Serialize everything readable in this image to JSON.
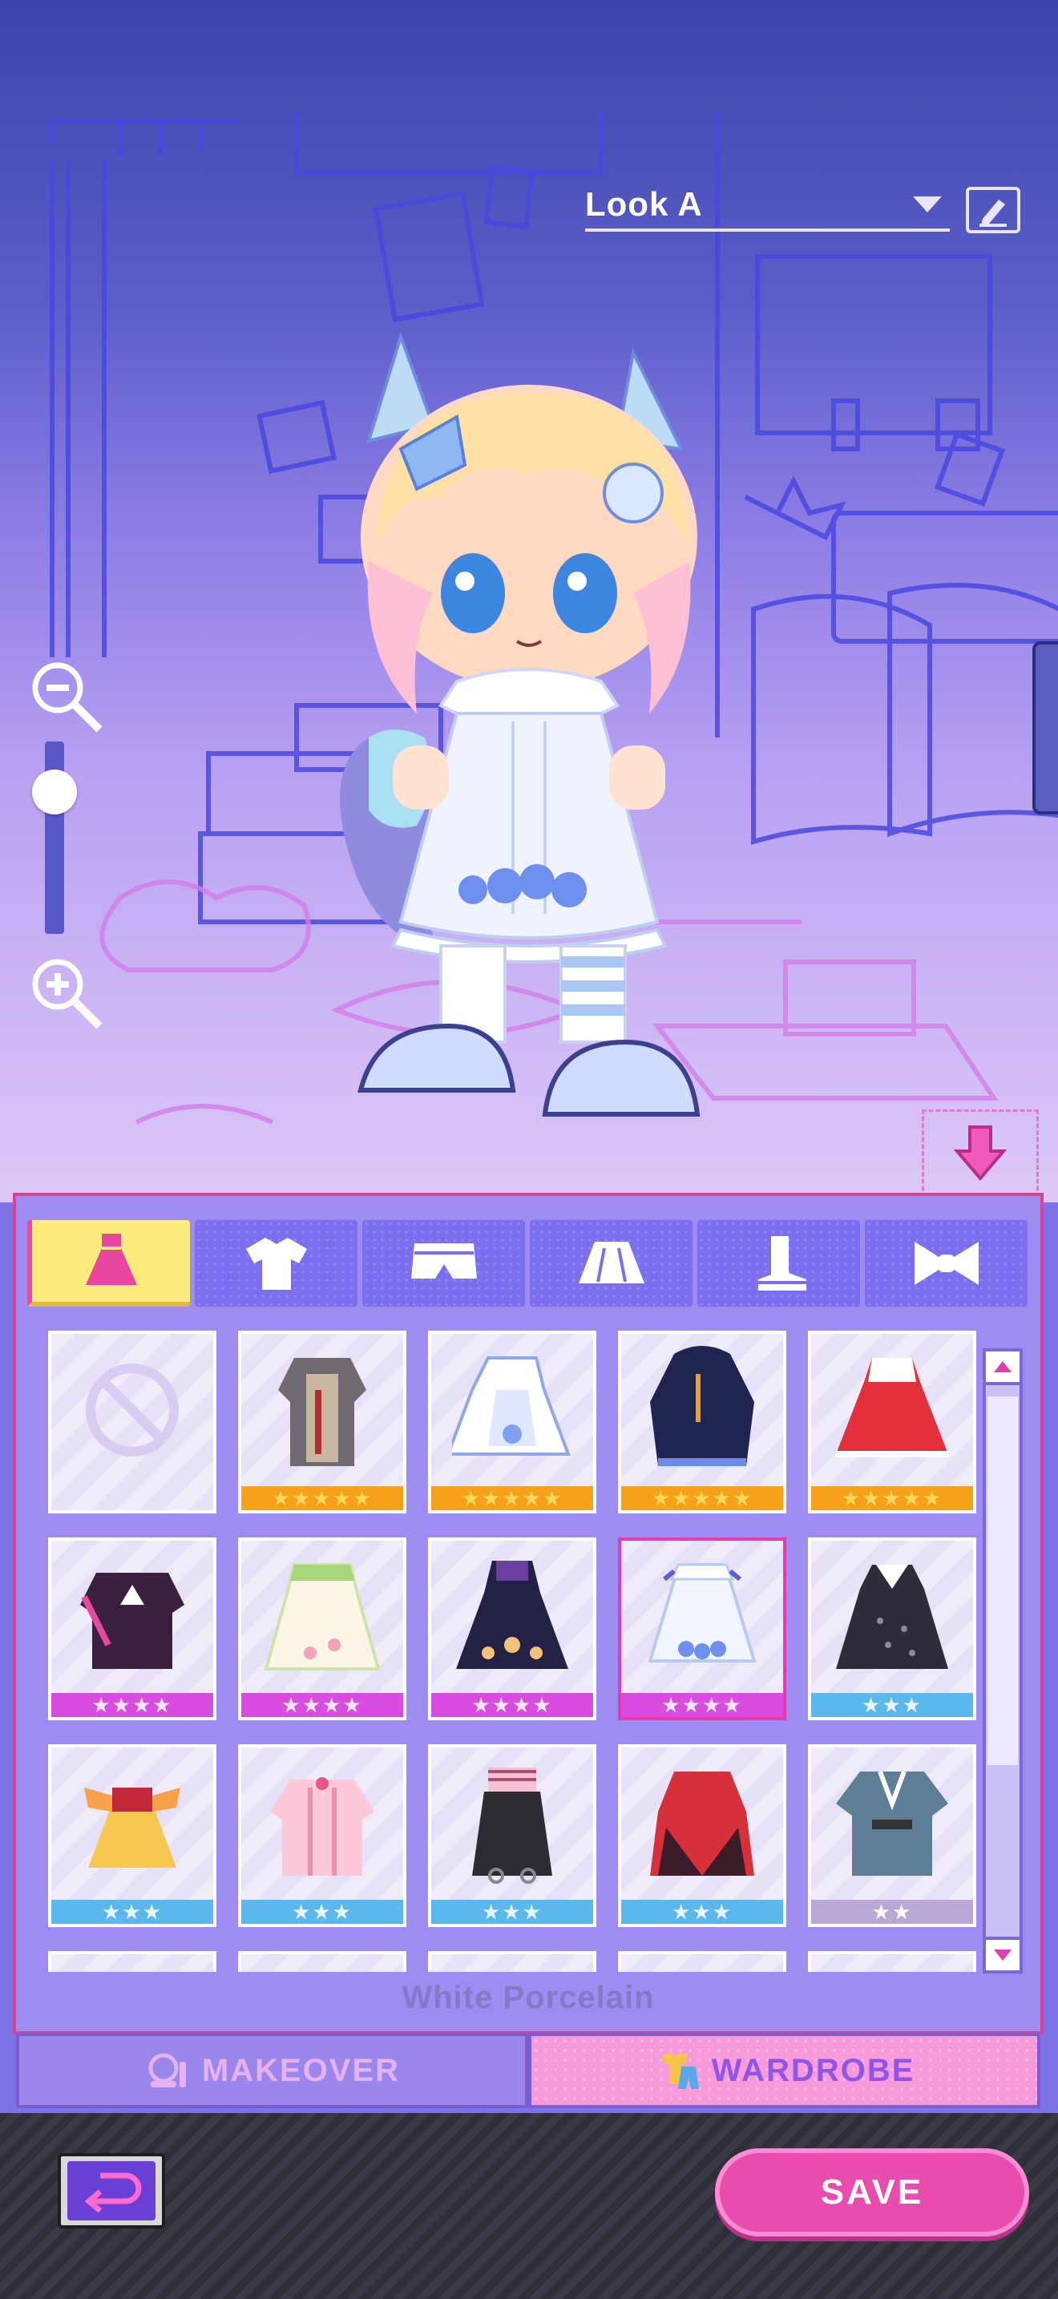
{
  "look": {
    "name": "Look A"
  },
  "panel": {
    "category_tabs": [
      {
        "name": "dress-icon",
        "active": true
      },
      {
        "name": "shirt-icon",
        "active": false
      },
      {
        "name": "shorts-icon",
        "active": false
      },
      {
        "name": "skirt-icon",
        "active": false
      },
      {
        "name": "boot-icon",
        "active": false
      },
      {
        "name": "bow-icon",
        "active": false
      }
    ],
    "items": [
      {
        "icon": "none-icon",
        "stars": "",
        "rarity": "none"
      },
      {
        "icon": "knight-armor-outfit-icon",
        "stars": "★★★★★",
        "rarity": "r5"
      },
      {
        "icon": "maid-outfit-icon",
        "stars": "★★★★★",
        "rarity": "r5"
      },
      {
        "icon": "dark-hooded-outfit-icon",
        "stars": "★★★★★",
        "rarity": "r5"
      },
      {
        "icon": "red-lolita-dress-icon",
        "stars": "★★★★★",
        "rarity": "r5"
      },
      {
        "icon": "black-jacket-2990-icon",
        "stars": "★★★★",
        "rarity": "r4"
      },
      {
        "icon": "green-ruffle-dress-icon",
        "stars": "★★★★",
        "rarity": "r4"
      },
      {
        "icon": "navy-flower-dress-icon",
        "stars": "★★★★",
        "rarity": "r4"
      },
      {
        "icon": "white-porcelain-dress-icon",
        "stars": "★★★★",
        "rarity": "r4",
        "selected": true
      },
      {
        "icon": "polka-dot-dress-icon",
        "stars": "★★★",
        "rarity": "r3"
      },
      {
        "icon": "yellow-corset-dress-icon",
        "stars": "★★★",
        "rarity": "r3"
      },
      {
        "icon": "pink-pajama-icon",
        "stars": "★★★",
        "rarity": "r3"
      },
      {
        "icon": "black-overalls-icon",
        "stars": "★★★",
        "rarity": "r3"
      },
      {
        "icon": "red-black-dress-icon",
        "stars": "★★★",
        "rarity": "r3"
      },
      {
        "icon": "blue-kimono-icon",
        "stars": "★★",
        "rarity": "r2"
      }
    ],
    "selected_item_name": "White Porcelain"
  },
  "bottom_tabs": {
    "makeover": "MAKEOVER",
    "wardrobe": "WARDROBE"
  },
  "footer": {
    "save": "SAVE"
  },
  "colors": {
    "accent": "#e84dae",
    "panel": "#9e8cf2",
    "active_tab": "#fbeb7c"
  }
}
